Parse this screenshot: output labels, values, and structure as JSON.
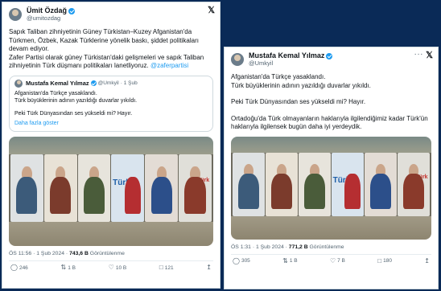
{
  "left": {
    "author_name": "Ümit Özdağ",
    "author_handle": "@umitozdag",
    "text": [
      "Sapık Taliban zihniyetinin Güney Türkistan–Kuzey Afganistan'da Türkmen, Özbek, Kazak Türklerine yönelik baskı, şiddet politikaları devam ediyor.",
      "Zafer Partisi olarak güney Türkistan'daki gelişmeleri ve sapık Taliban zihniyetinin Türk düşmanı politikaları lanetliyoruz."
    ],
    "hashtag": "@zaferpartisi",
    "quote": {
      "author_name": "Mustafa Kemal Yılmaz",
      "author_handle": "@Umkyil",
      "time": "· 1 Şub",
      "lines": [
        "Afganistan'da Türkçe yasaklandı.",
        "Türk büyüklerinin adının yazıldığı duvarlar yıkıldı.",
        "",
        "Peki Türk Dünyasından ses yükseldi mi? Hayır."
      ],
      "show_more": "Daha fazla göster"
    },
    "wall_text_1": "Türk",
    "wall_text_2": "Türk",
    "meta_time": "ÖS 11:56 · 1 Şub 2024 · ",
    "meta_views": "743,6 B",
    "meta_views_label": " Görüntülenme",
    "replies": "246",
    "retweets": "1 B",
    "likes": "10 B",
    "bookmarks": "121"
  },
  "right": {
    "author_name": "Mustafa Kemal Yılmaz",
    "author_handle": "@Umkyil",
    "text": [
      "Afganistan'da Türkçe yasaklandı.",
      "Türk büyüklerinin adının yazıldığı duvarlar yıkıldı.",
      "",
      "Peki Türk Dünyasından ses yükseldi mi? Hayır.",
      "",
      "Ortadoğu'da Türk olmayanların haklarıyla ilgilendiğimiz kadar Türk'ün haklarıyla ilgilensek bugün daha iyi yerdeydik."
    ],
    "wall_text_1": "Türk",
    "wall_text_2": "Türk",
    "meta_time": "ÖS 1:31 · 1 Şub 2024 · ",
    "meta_views": "771,2 B",
    "meta_views_label": " Görüntülenme",
    "replies": "305",
    "retweets": "1 B",
    "likes": "7 B",
    "bookmarks": "180"
  },
  "colors": {
    "background": "#0a2a57",
    "link": "#1d9bf0",
    "verified": "#1d9bf0"
  }
}
